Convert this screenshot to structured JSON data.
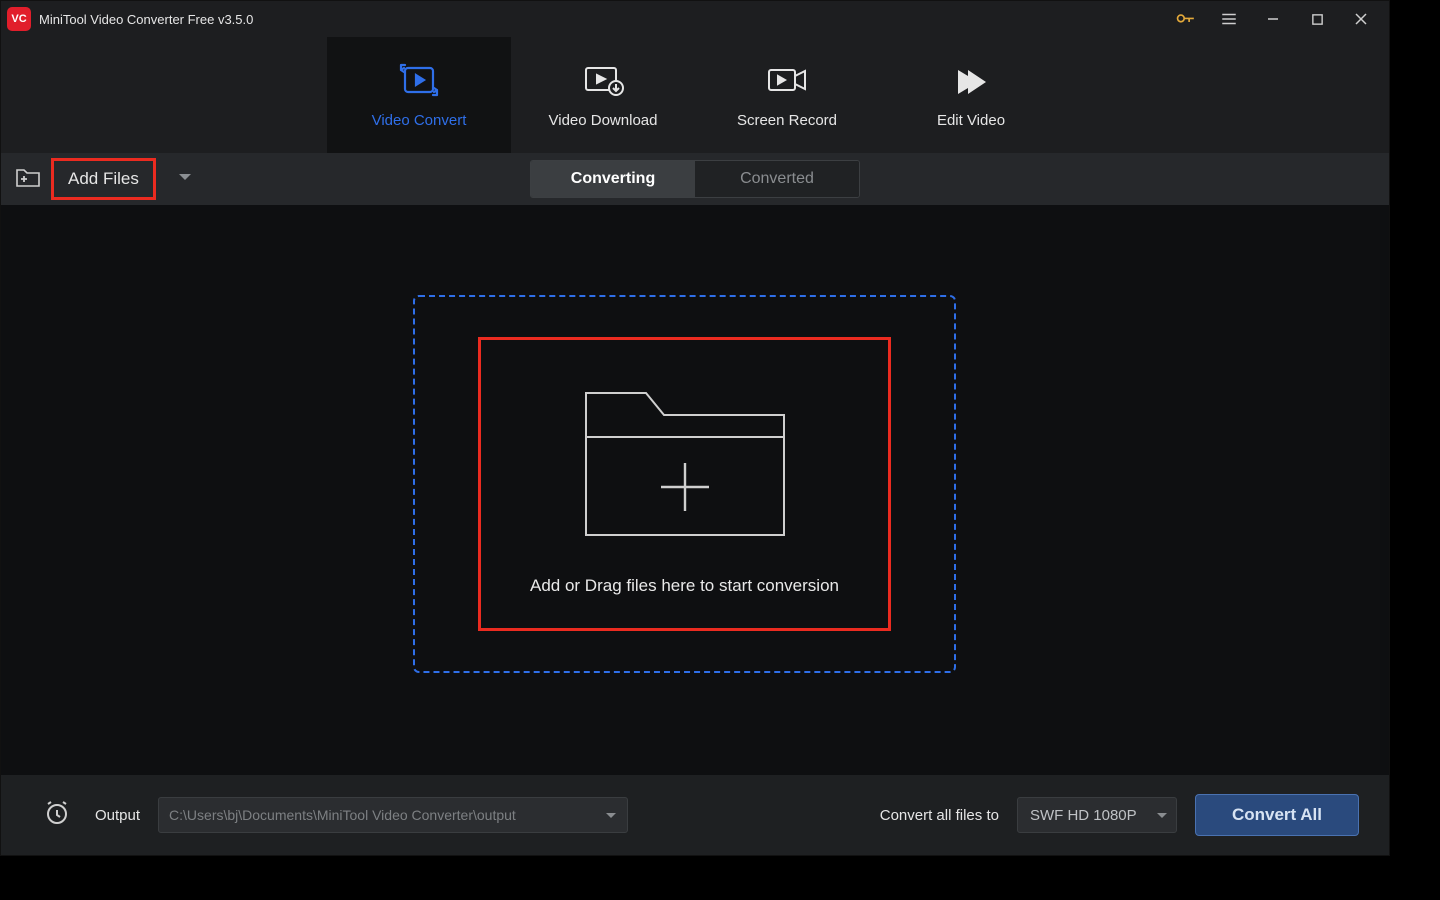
{
  "title": "MiniTool Video Converter Free v3.5.0",
  "topnav": {
    "video_convert": "Video Convert",
    "video_download": "Video Download",
    "screen_record": "Screen Record",
    "edit_video": "Edit Video"
  },
  "toolbar": {
    "add_files": "Add Files",
    "converting": "Converting",
    "converted": "Converted"
  },
  "dropzone": {
    "text": "Add or Drag files here to start conversion"
  },
  "footer": {
    "output_label": "Output",
    "output_path": "C:\\Users\\bj\\Documents\\MiniTool Video Converter\\output",
    "convert_all_label": "Convert all files to",
    "format": "SWF HD 1080P",
    "convert_all_btn": "Convert All"
  }
}
